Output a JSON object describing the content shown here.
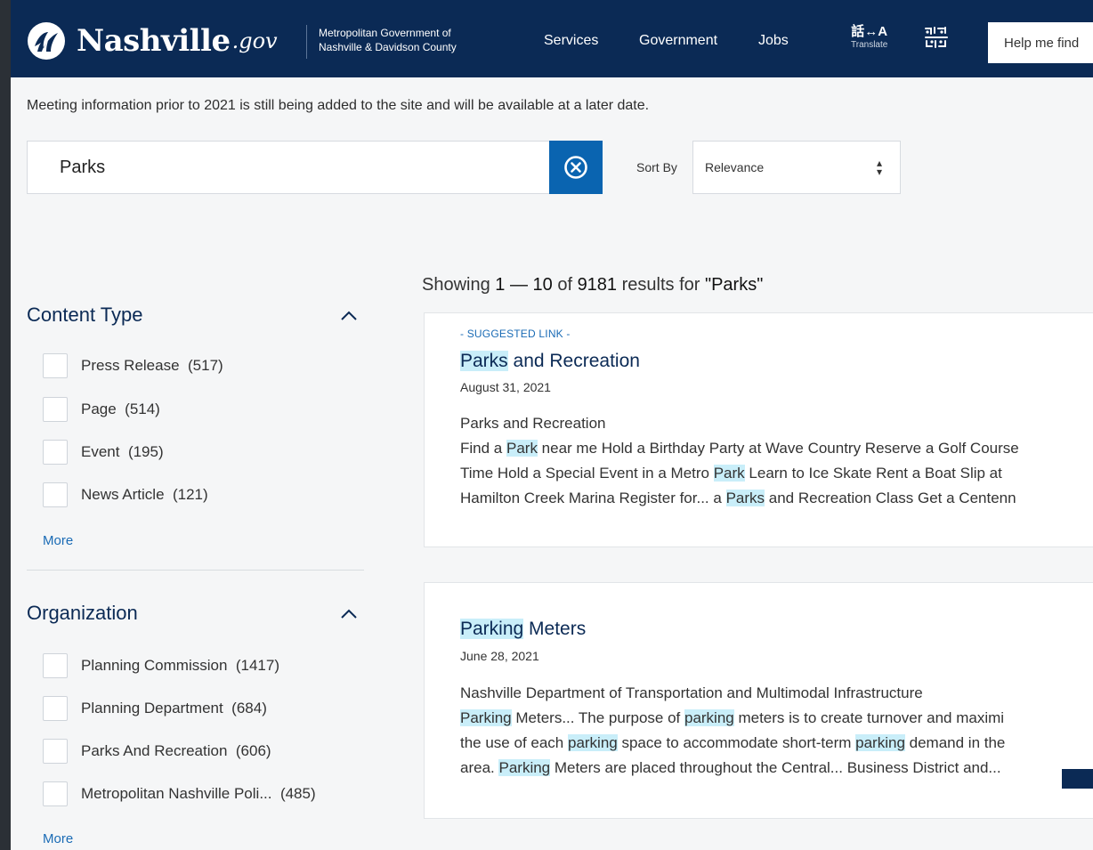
{
  "header": {
    "brand_name": "Nashville",
    "brand_suffix": ".gov",
    "metro_line1": "Metropolitan Government of",
    "metro_line2": "Nashville & Davidson County",
    "nav": [
      {
        "label": "Services"
      },
      {
        "label": "Government"
      },
      {
        "label": "Jobs"
      }
    ],
    "translate_glyph": "話↔A",
    "translate_label": "Translate",
    "help_placeholder": "Help me find"
  },
  "notice": "Meeting information prior to 2021 is still being added to the site and will be available at a later date.",
  "search": {
    "value": "Parks",
    "sort_label": "Sort By",
    "sort_value": "Relevance"
  },
  "facets": {
    "content_type": {
      "title": "Content Type",
      "items": [
        {
          "label": "Press Release",
          "count": "(517)"
        },
        {
          "label": "Page",
          "count": "(514)"
        },
        {
          "label": "Event",
          "count": "(195)"
        },
        {
          "label": "News Article",
          "count": "(121)"
        }
      ],
      "more": "More"
    },
    "organization": {
      "title": "Organization",
      "items": [
        {
          "label": "Planning Commission",
          "count": "(1417)"
        },
        {
          "label": "Planning Department",
          "count": "(684)"
        },
        {
          "label": "Parks And Recreation",
          "count": "(606)"
        },
        {
          "label": "Metropolitan Nashville Poli...",
          "count": " (485)"
        }
      ],
      "more": "More"
    }
  },
  "results": {
    "summary_prefix": "Showing ",
    "range": "1 — 10",
    "of": " of ",
    "total": "9181",
    "results_for": " results for ",
    "query": "\"Parks\"",
    "items": [
      {
        "tag": "- SUGGESTED LINK -",
        "title_hl": "Parks",
        "title_rest": " and Recreation",
        "date": "August 31, 2021",
        "dept": "Parks and Recreation",
        "line1_a": "Find a ",
        "line1_hl": "Park",
        "line1_b": " near me Hold a Birthday Party at Wave Country Reserve a Golf Course",
        "line2_a": "Time Hold a Special Event in a Metro ",
        "line2_hl": "Park",
        "line2_b": " Learn to Ice Skate Rent a Boat Slip at",
        "line3_a": "Hamilton Creek Marina Register for... a ",
        "line3_hl": "Parks",
        "line3_b": " and Recreation Class Get a Centenn"
      },
      {
        "title_hl": "Parking",
        "title_rest": " Meters",
        "date": "June 28, 2021",
        "dept": "Nashville Department of Transportation and Multimodal Infrastructure",
        "line1_hl": "Parking",
        "line1_a": " Meters... The purpose of ",
        "line1_hl2": "parking",
        "line1_b": " meters is to create turnover and maximi",
        "line2_a": "the use of each ",
        "line2_hl": "parking",
        "line2_b": " space to accommodate short-term ",
        "line2_hl2": "parking",
        "line2_c": " demand in the",
        "line3_a": "area. ",
        "line3_hl": "Parking",
        "line3_b": " Meters are placed throughout the Central... Business District and..."
      }
    ]
  },
  "colors": {
    "header_bg": "#0b2a55",
    "accent_blue": "#0a64b0",
    "link_blue": "#1a6bb5",
    "highlight": "#c9eef9"
  }
}
